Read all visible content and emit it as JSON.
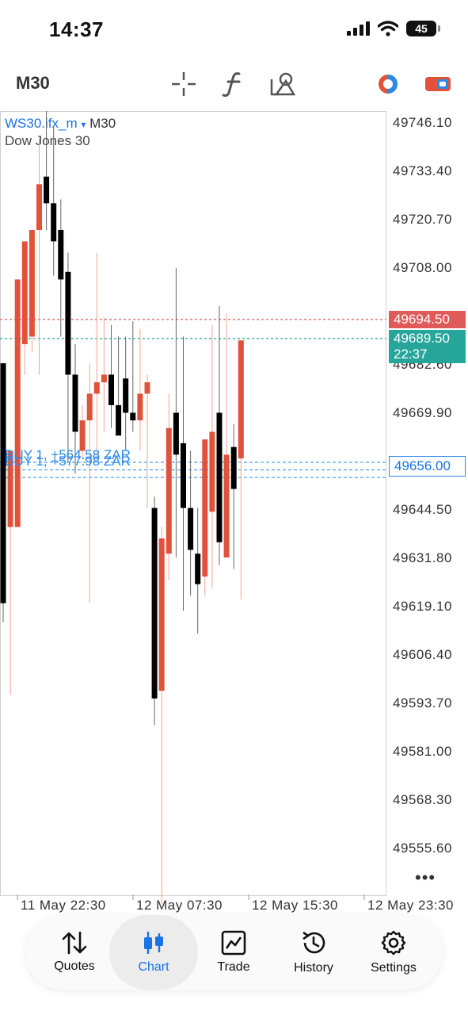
{
  "status_bar": {
    "time": "14:37",
    "battery": "45"
  },
  "toolbar": {
    "timeframe": "M30",
    "tools": [
      "crosshair-icon",
      "indicator-f-icon",
      "objects-icon",
      "color-scheme-icon",
      "switch-icon"
    ]
  },
  "chart_header": {
    "symbol": "WS30.ifx_m",
    "dropdown": "▾",
    "timeframe": "M30",
    "name": "Dow Jones 30"
  },
  "price_axis": [
    "49746.10",
    "49733.40",
    "49720.70",
    "49708.00",
    "49682.60",
    "49669.90",
    "49644.50",
    "49631.80",
    "49619.10",
    "49606.40",
    "49593.70",
    "49581.00",
    "49568.30",
    "49555.60"
  ],
  "tags": {
    "ask": "49694.50",
    "bid": "49689.50",
    "timer": "22:37",
    "position": "49656.00"
  },
  "trade_labels": [
    "BUY 1, +564.58 ZAR",
    "BUY 1, +577.98 ZAR"
  ],
  "time_axis": [
    "11 May 22:30",
    "12 May 07:30",
    "12 May 15:30",
    "12 May 23:30"
  ],
  "more": "•••",
  "nav": {
    "items": [
      {
        "label": "Quotes",
        "icon": "quotes-arrows-icon"
      },
      {
        "label": "Chart",
        "icon": "candles-icon"
      },
      {
        "label": "Trade",
        "icon": "trade-chart-icon"
      },
      {
        "label": "History",
        "icon": "history-icon"
      },
      {
        "label": "Settings",
        "icon": "gear-icon"
      }
    ],
    "active": "Chart"
  },
  "colors": {
    "bull": "#e0533a",
    "bear": "#000000",
    "accent": "#1a73e8",
    "ask_line": "#e05a5a",
    "bid_line": "#26a69a"
  },
  "chart_data": {
    "type": "candlestick",
    "ylim": [
      49550,
      49752
    ],
    "candles": [
      {
        "o": 49683,
        "h": 49683,
        "l": 49615,
        "c": 49620
      },
      {
        "o": 49640,
        "h": 49650,
        "l": 49596,
        "c": 49660
      },
      {
        "o": 49640,
        "h": 49705,
        "l": 49640,
        "c": 49705
      },
      {
        "o": 49688,
        "h": 49710,
        "l": 49680,
        "c": 49715
      },
      {
        "o": 49690,
        "h": 49712,
        "l": 49686,
        "c": 49718
      },
      {
        "o": 49718,
        "h": 49742,
        "l": 49680,
        "c": 49730
      },
      {
        "o": 49732,
        "h": 49752,
        "l": 49718,
        "c": 49725
      },
      {
        "o": 49725,
        "h": 49745,
        "l": 49706,
        "c": 49715
      },
      {
        "o": 49718,
        "h": 49726,
        "l": 49690,
        "c": 49705
      },
      {
        "o": 49707,
        "h": 49712,
        "l": 49657,
        "c": 49680
      },
      {
        "o": 49680,
        "h": 49688,
        "l": 49654,
        "c": 49665
      },
      {
        "o": 49660,
        "h": 49672,
        "l": 49658,
        "c": 49668
      },
      {
        "o": 49668,
        "h": 49683,
        "l": 49620,
        "c": 49675
      },
      {
        "o": 49675,
        "h": 49712,
        "l": 49658,
        "c": 49678
      },
      {
        "o": 49678,
        "h": 49695,
        "l": 49665,
        "c": 49680
      },
      {
        "o": 49680,
        "h": 49693,
        "l": 49666,
        "c": 49672
      },
      {
        "o": 49672,
        "h": 49690,
        "l": 49666,
        "c": 49664
      },
      {
        "o": 49679,
        "h": 49690,
        "l": 49660,
        "c": 49670
      },
      {
        "o": 49670,
        "h": 49694,
        "l": 49665,
        "c": 49668
      },
      {
        "o": 49668,
        "h": 49692,
        "l": 49660,
        "c": 49675
      },
      {
        "o": 49675,
        "h": 49680,
        "l": 49645,
        "c": 49678
      },
      {
        "o": 49645,
        "h": 49648,
        "l": 49588,
        "c": 49595
      },
      {
        "o": 49597,
        "h": 49640,
        "l": 49530,
        "c": 49637
      },
      {
        "o": 49633,
        "h": 49675,
        "l": 49626,
        "c": 49666
      },
      {
        "o": 49670,
        "h": 49708,
        "l": 49632,
        "c": 49659
      },
      {
        "o": 49662,
        "h": 49690,
        "l": 49618,
        "c": 49645
      },
      {
        "o": 49645,
        "h": 49660,
        "l": 49622,
        "c": 49634
      },
      {
        "o": 49633,
        "h": 49645,
        "l": 49612,
        "c": 49625
      },
      {
        "o": 49627,
        "h": 49652,
        "l": 49622,
        "c": 49663
      },
      {
        "o": 49644,
        "h": 49693,
        "l": 49624,
        "c": 49665
      },
      {
        "o": 49670,
        "h": 49698,
        "l": 49630,
        "c": 49636
      },
      {
        "o": 49632,
        "h": 49696,
        "l": 49633,
        "c": 49659
      },
      {
        "o": 49661,
        "h": 49667,
        "l": 49629,
        "c": 49650
      },
      {
        "o": 49658,
        "h": 49687,
        "l": 49621,
        "c": 49689
      }
    ]
  }
}
